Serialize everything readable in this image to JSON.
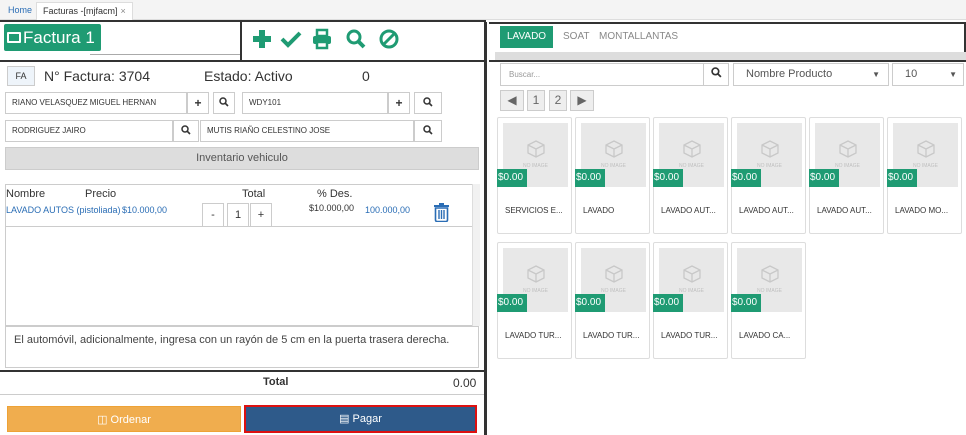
{
  "tabs": {
    "home": "Home",
    "active": "Facturas -[mjfacm]",
    "close": "×"
  },
  "factura": {
    "title": "Factura 1",
    "doc_type": "FA",
    "number_label": "N° Factura: 3704",
    "status_label": "Estado: Activo",
    "count": "0"
  },
  "fields": {
    "cliente": "RIANO VELASQUEZ MIGUEL HERNAN",
    "placa": "WDY101",
    "vendedor": "RODRIGUEZ JAIRO",
    "operario": "MUTIS RIAÑO CELESTINO JOSE"
  },
  "inventario_label": "Inventario vehiculo",
  "list": {
    "headers": {
      "nombre": "Nombre",
      "precio": "Precio",
      "total": "Total",
      "descuento": "% Des."
    },
    "items": [
      {
        "name": "LAVADO AUTOS (pistoliada)",
        "price": "$10.000,00",
        "qty": "1",
        "total": "$10.000,00",
        "discount": "100.000,00"
      }
    ],
    "minus": "-",
    "plus": "+"
  },
  "note": "El automóvil, adicionalmente, ingresa con un rayón de 5 cm en la puerta trasera derecha.",
  "totals": {
    "label": "Total",
    "value": "0.00"
  },
  "buttons": {
    "ordenar": "Ordenar",
    "pagar": "Pagar"
  },
  "right": {
    "tabs": [
      "LAVADO",
      "SOAT",
      "MONTALLANTAS"
    ],
    "search_placeholder": "Buscar...",
    "sort": "Nombre Producto",
    "page_size": "10",
    "pages": [
      "1",
      "2"
    ],
    "no_image": "NO IMAGE",
    "products": [
      {
        "name": "SERVICIOS E...",
        "price": "$0.00"
      },
      {
        "name": "LAVADO",
        "price": "$0.00"
      },
      {
        "name": "LAVADO AUT...",
        "price": "$0.00"
      },
      {
        "name": "LAVADO AUT...",
        "price": "$0.00"
      },
      {
        "name": "LAVADO AUT...",
        "price": "$0.00"
      },
      {
        "name": "LAVADO MO...",
        "price": "$0.00"
      },
      {
        "name": "LAVADO TUR...",
        "price": "$0.00"
      },
      {
        "name": "LAVADO TUR...",
        "price": "$0.00"
      },
      {
        "name": "LAVADO TUR...",
        "price": "$0.00"
      },
      {
        "name": "LAVADO CA...",
        "price": "$0.00"
      }
    ]
  },
  "colors": {
    "brand": "#1f9b73",
    "pay": "#2e5a8a",
    "order": "#f0ad4e"
  }
}
